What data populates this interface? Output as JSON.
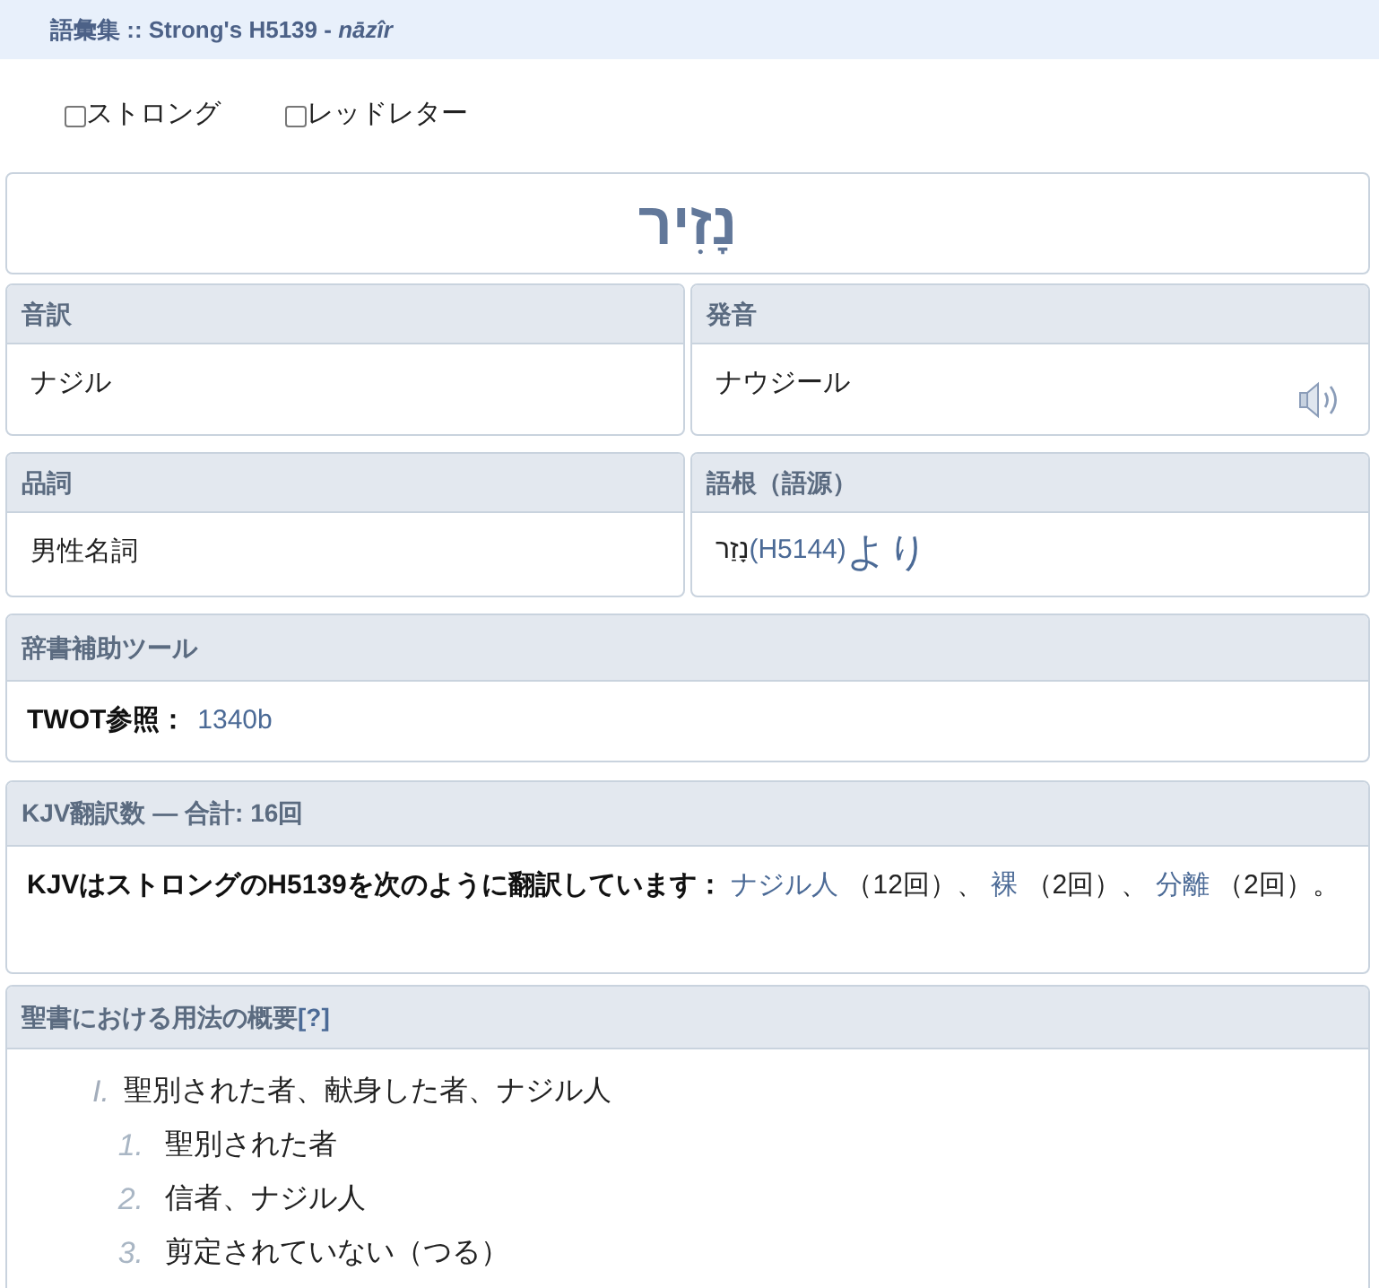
{
  "header": {
    "title": "語彙集 :: Strong's H5139 - *nāzîr*"
  },
  "toggles": [
    {
      "label": "ストロング",
      "checked": false
    },
    {
      "label": "レッドレター",
      "checked": false
    }
  ],
  "headword": "נָזִיר",
  "info_cards": [
    {
      "title": "音訳",
      "kind": "text",
      "value": "ナジル"
    },
    {
      "title": "発音",
      "kind": "audio",
      "value": "ナウジール"
    },
    {
      "title": "品詞",
      "kind": "text",
      "value": "男性名詞"
    },
    {
      "title": "語根（語源）",
      "kind": "root",
      "hebrew": "נָזַר",
      "link": "(H5144)",
      "suffix": "より"
    }
  ],
  "tools": {
    "title": "辞書補助ツール",
    "label": "TWOT参照：",
    "link": "1340b"
  },
  "kjv": {
    "title": "KJV翻訳数 — 合計: 16回",
    "lead": "KJVはストロングのH5139を次のように翻訳しています：",
    "translations": [
      {
        "word": "ナジル人",
        "count": "（12回）、"
      },
      {
        "word": "裸",
        "count": "（2回）、"
      },
      {
        "word": "分離",
        "count": "（2回）。"
      }
    ]
  },
  "usage": {
    "title": "聖書における用法の概要",
    "help_link": "[?]",
    "outline": [
      {
        "marker": "I.",
        "text": "聖別された者、献身した者、ナジル人",
        "children": [
          {
            "marker": "1.",
            "text": "聖別された者"
          },
          {
            "marker": "2.",
            "text": "信者、ナジル人"
          },
          {
            "marker": "3.",
            "text": "剪定されていない（つる）"
          }
        ]
      }
    ]
  }
}
